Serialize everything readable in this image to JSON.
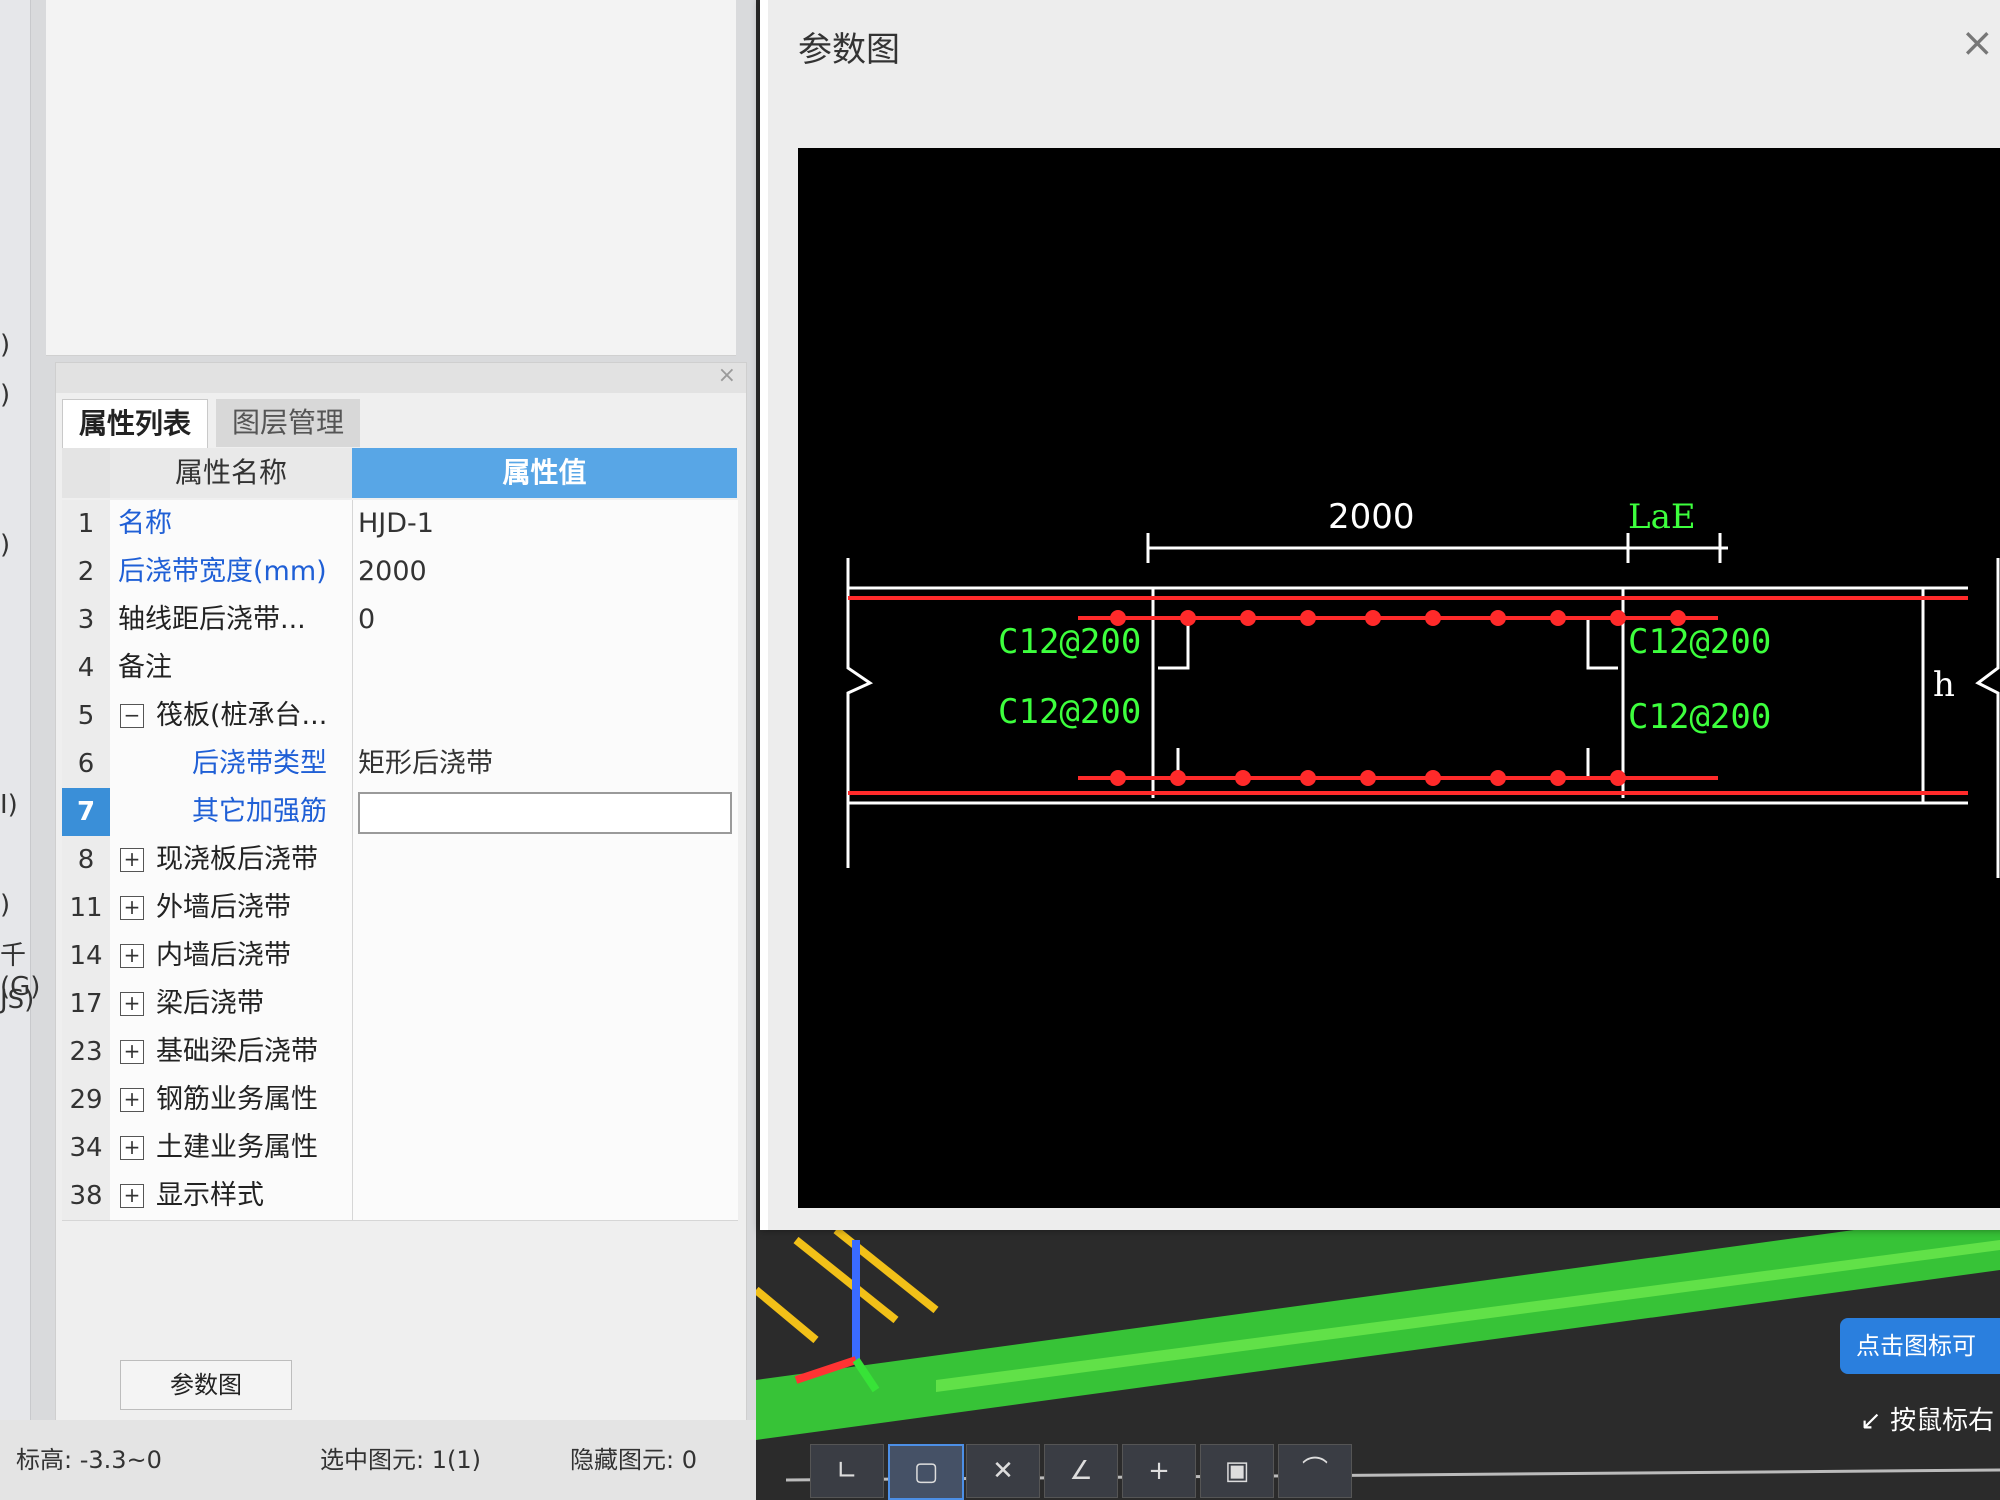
{
  "left_strip": {
    "labels": [
      ")",
      ")",
      ")",
      "I)",
      ")",
      "千(G)",
      "JS)"
    ]
  },
  "panel": {
    "tabs": [
      "属性列表",
      "图层管理"
    ],
    "header": {
      "name": "属性名称",
      "value": "属性值"
    },
    "rows": [
      {
        "num": "1",
        "name": "名称",
        "value": "HJD-1"
      },
      {
        "num": "2",
        "name": "后浇带宽度(mm)",
        "value": "2000"
      },
      {
        "num": "3",
        "name": "轴线距后浇带...",
        "value": "0"
      },
      {
        "num": "4",
        "name": "备注",
        "value": ""
      },
      {
        "num": "5",
        "toggle": "−",
        "name": "筏板(桩承台...",
        "value": ""
      },
      {
        "num": "6",
        "name": "后浇带类型",
        "value": "矩形后浇带"
      },
      {
        "num": "7",
        "name": "其它加强筋",
        "value": ""
      },
      {
        "num": "8",
        "toggle": "+",
        "name": "现浇板后浇带",
        "value": ""
      },
      {
        "num": "11",
        "toggle": "+",
        "name": "外墙后浇带",
        "value": ""
      },
      {
        "num": "14",
        "toggle": "+",
        "name": "内墙后浇带",
        "value": ""
      },
      {
        "num": "17",
        "toggle": "+",
        "name": "梁后浇带",
        "value": ""
      },
      {
        "num": "23",
        "toggle": "+",
        "name": "基础梁后浇带",
        "value": ""
      },
      {
        "num": "29",
        "toggle": "+",
        "name": "钢筋业务属性",
        "value": ""
      },
      {
        "num": "34",
        "toggle": "+",
        "name": "土建业务属性",
        "value": ""
      },
      {
        "num": "38",
        "toggle": "+",
        "name": "显示样式",
        "value": ""
      }
    ],
    "param_button": "参数图"
  },
  "status": {
    "elevation": "标高:  -3.3~0",
    "selected": "选中图元: 1(1)",
    "hidden": "隐藏图元: 0"
  },
  "dialog": {
    "title": "参数图",
    "close": "×",
    "drawing": {
      "dim_width": "2000",
      "dim_lae": "LaE",
      "rebar_top_left": "C12@200",
      "rebar_bottom_left": "C12@200",
      "rebar_top_right": "C12@200",
      "rebar_bottom_right": "C12@200",
      "height_label": "h"
    }
  },
  "overlay": {
    "badge": "点击图标可",
    "hint": "按鼠标右"
  },
  "toolbar": {
    "icons": [
      "corner-icon",
      "rect-icon",
      "x-icon",
      "angle-icon",
      "plus-icon",
      "monitor-icon",
      "arc-icon"
    ]
  },
  "colors": {
    "accent": "#58a6e6",
    "selected_row": "#3a8fd8",
    "drawing_rebar": "#ff2a2a",
    "drawing_label": "#3dff3d",
    "drawing_line": "#ffffff",
    "field_3d": "#37c337"
  }
}
